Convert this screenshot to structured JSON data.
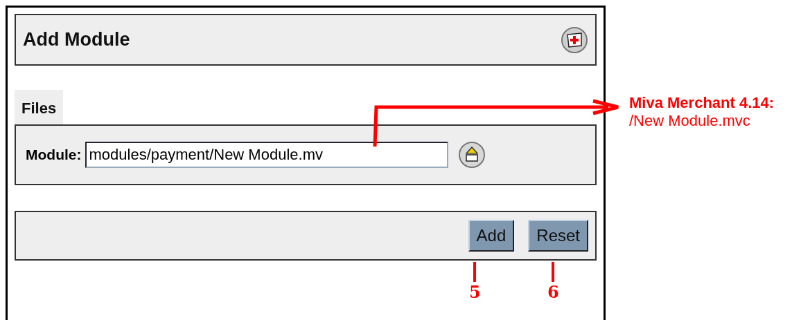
{
  "header": {
    "title": "Add Module"
  },
  "tabs": [
    {
      "label": "Files",
      "selected": true
    }
  ],
  "field": {
    "label": "Module:",
    "value": "modules/payment/New Module.mv"
  },
  "buttons": [
    {
      "label": "Add",
      "marker": "5"
    },
    {
      "label": "Reset",
      "marker": "6"
    }
  ],
  "callout": {
    "title": "Miva Merchant 4.14:",
    "text": "/New Module.mvc"
  }
}
